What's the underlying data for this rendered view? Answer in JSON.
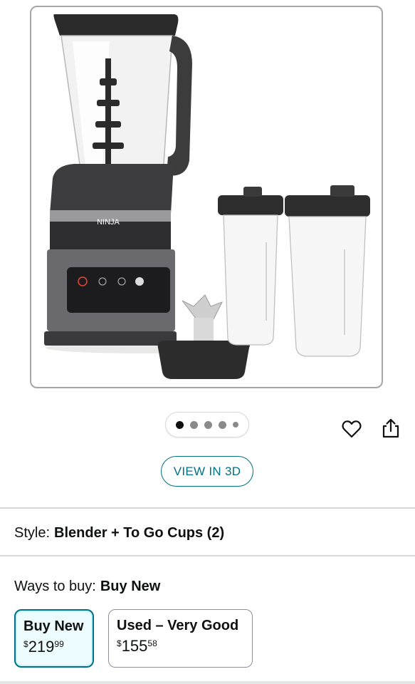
{
  "product_image": {
    "alt": "Ninja blender with two to-go cups",
    "brand_mark": "NINJA"
  },
  "carousel": {
    "total": 5,
    "active_index": 0
  },
  "actions": {
    "wishlist_icon": "heart-icon",
    "share_icon": "share-icon"
  },
  "view_3d": {
    "label": "VIEW IN 3D"
  },
  "style": {
    "label": "Style:",
    "value": "Blender + To Go Cups (2)"
  },
  "ways_to_buy": {
    "label": "Ways to buy:",
    "value": "Buy New"
  },
  "options": [
    {
      "title": "Buy New",
      "currency": "$",
      "whole": "219",
      "fraction": "99",
      "selected": true
    },
    {
      "title": "Used – Very Good",
      "currency": "$",
      "whole": "155",
      "fraction": "58",
      "selected": false
    }
  ],
  "colors": {
    "accent": "#007185",
    "text": "#0f1111",
    "border": "#d5d9d9"
  }
}
